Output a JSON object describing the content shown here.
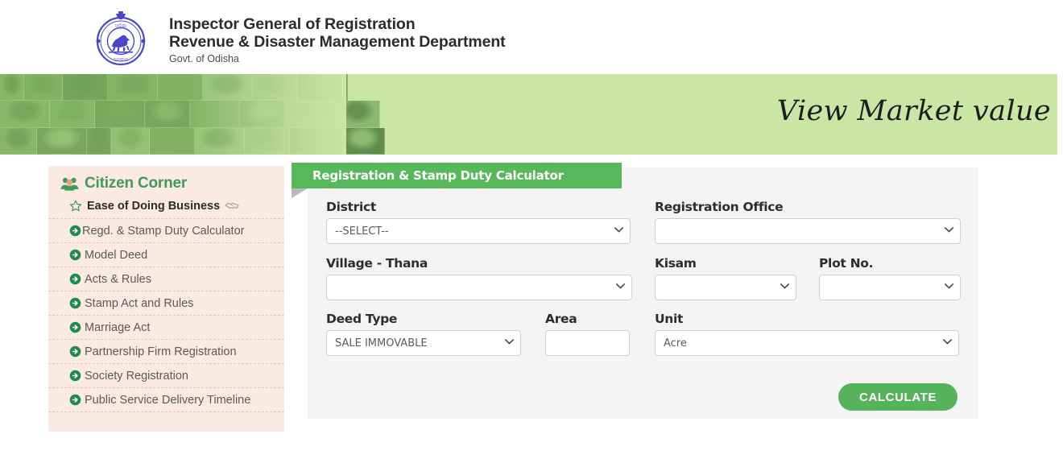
{
  "header": {
    "emblem_icon": "odisha-state-emblem",
    "title_line1": "Inspector General of Registration",
    "title_line2": "Revenue & Disaster Management Department",
    "subtitle": "Govt. of Odisha"
  },
  "banner": {
    "title": "View Market value",
    "background_color": "#c9e6a4",
    "photo_mosaic_icon": "citizens-photo-collage"
  },
  "sidebar": {
    "heading": "Citizen Corner",
    "heading_icon": "users-group-icon",
    "heading_color": "#3f9b5b",
    "background_color": "#fbeae1",
    "featured": {
      "label": "Ease of Doing Business",
      "leading_icon": "star-icon",
      "trailing_icon": "handshake-icon"
    },
    "items": [
      {
        "label": "Regd. & Stamp Duty Calculator",
        "icon": "arrow-circle-right-icon"
      },
      {
        "label": "Model Deed",
        "icon": "arrow-circle-right-icon"
      },
      {
        "label": "Acts & Rules",
        "icon": "arrow-circle-right-icon"
      },
      {
        "label": "Stamp Act and Rules",
        "icon": "arrow-circle-right-icon"
      },
      {
        "label": "Marriage Act",
        "icon": "arrow-circle-right-icon"
      },
      {
        "label": "Partnership Firm Registration",
        "icon": "arrow-circle-right-icon"
      },
      {
        "label": "Society Registration",
        "icon": "arrow-circle-right-icon"
      },
      {
        "label": "Public Service Delivery Timeline",
        "icon": "arrow-circle-right-icon"
      }
    ]
  },
  "calculator": {
    "panel_title": "Registration & Stamp Duty Calculator",
    "header_color": "#57b85b",
    "panel_background": "#f4f4f4",
    "fields": {
      "district": {
        "label": "District",
        "value": "--SELECT--",
        "icon": "chevron-down-icon"
      },
      "registration_office": {
        "label": "Registration Office",
        "value": "",
        "icon": "chevron-down-icon"
      },
      "village_thana": {
        "label": "Village - Thana",
        "value": "",
        "icon": "chevron-down-icon"
      },
      "kisam": {
        "label": "Kisam",
        "value": "",
        "icon": "chevron-down-icon"
      },
      "plot_no": {
        "label": "Plot No.",
        "value": "",
        "icon": "chevron-down-icon"
      },
      "deed_type": {
        "label": "Deed Type",
        "value": "SALE IMMOVABLE",
        "icon": "chevron-down-icon"
      },
      "area": {
        "label": "Area",
        "value": "",
        "placeholder": ""
      },
      "unit": {
        "label": "Unit",
        "value": "Acre",
        "icon": "chevron-down-icon"
      }
    },
    "submit_label": "CALCULATE",
    "submit_color": "#55b35c"
  }
}
